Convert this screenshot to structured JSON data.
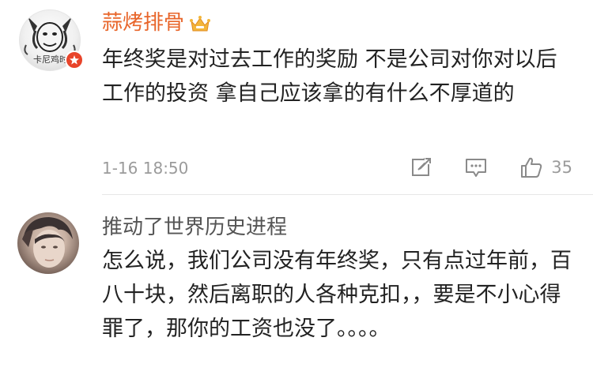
{
  "comments": [
    {
      "username": "蒜烤排骨",
      "avatar_caption": "卡尼鸡时",
      "text": "年终奖是对过去工作的奖励 不是公司对你对以后工作的投资 拿自己应该拿的有什么不厚道的",
      "timestamp": "1-16 18:50",
      "likes": "35",
      "icons": [
        "crown-icon",
        "verified-badge-icon",
        "share-icon",
        "reply-icon",
        "like-icon"
      ]
    },
    {
      "username": "推动了世界历史进程",
      "text": "怎么说，我们公司没有年终奖，只有点过年前，百八十块，然后离职的人各种克扣，，要是不小心得罪了，那你的工资也没了。。。。"
    }
  ],
  "colors": {
    "vip_name": "#e8652a",
    "name": "#555555",
    "body_text": "#222222",
    "meta": "#9b9b9b",
    "badge": "#e8442a",
    "crown": "#f3b63a"
  }
}
